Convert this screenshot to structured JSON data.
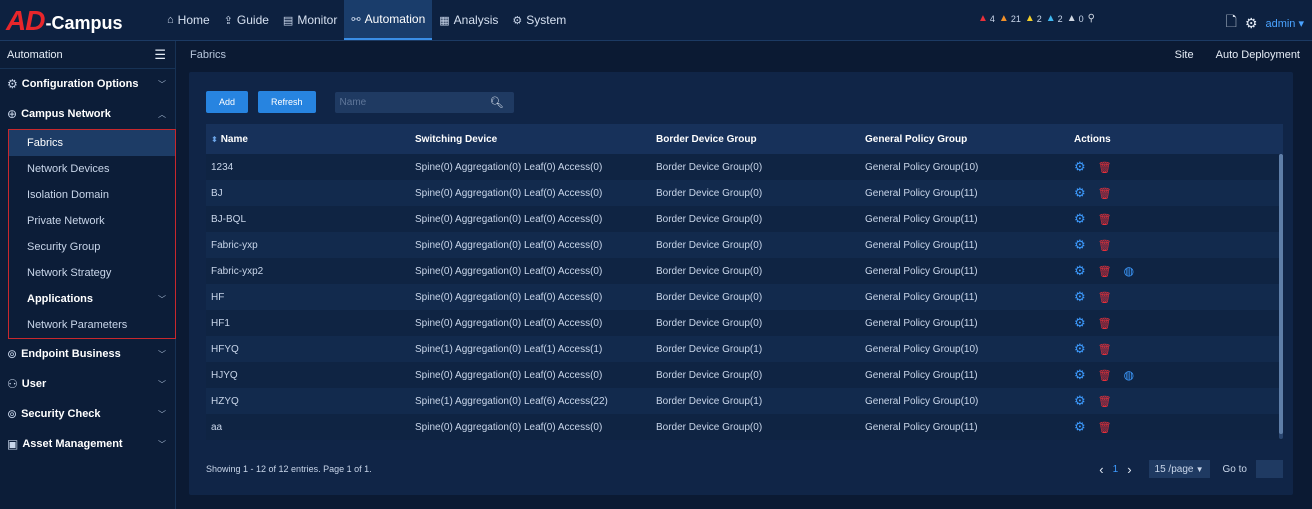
{
  "brand": {
    "logo_ad": "AD",
    "logo_rest": "-Campus"
  },
  "nav": [
    {
      "icon": "⌂",
      "label": "Home",
      "active": false
    },
    {
      "icon": "⇪",
      "label": "Guide",
      "active": false
    },
    {
      "icon": "▤",
      "label": "Monitor",
      "active": false
    },
    {
      "icon": "⚯",
      "label": "Automation",
      "active": true
    },
    {
      "icon": "▦",
      "label": "Analysis",
      "active": false
    },
    {
      "icon": "⚙",
      "label": "System",
      "active": false
    }
  ],
  "alerts": [
    {
      "count": "4",
      "color": "#e8303a"
    },
    {
      "count": "21",
      "color": "#f0902a"
    },
    {
      "count": "2",
      "color": "#f3cf2a"
    },
    {
      "count": "2",
      "color": "#3fb7f0"
    },
    {
      "count": "0",
      "color": "#d0d7e2"
    }
  ],
  "user": {
    "name": "admin"
  },
  "sidebar": {
    "title": "Automation",
    "groups_top": [
      {
        "icon": "⚙",
        "label": "Configuration Options"
      },
      {
        "icon": "⊕",
        "label": "Campus Network"
      }
    ],
    "sub_items": [
      {
        "label": "Fabrics",
        "active": true,
        "bold": false
      },
      {
        "label": "Network Devices",
        "active": false,
        "bold": false
      },
      {
        "label": "Isolation Domain",
        "active": false,
        "bold": false
      },
      {
        "label": "Private Network",
        "active": false,
        "bold": false
      },
      {
        "label": "Security Group",
        "active": false,
        "bold": false
      },
      {
        "label": "Network Strategy",
        "active": false,
        "bold": false
      },
      {
        "label": "Applications",
        "active": false,
        "bold": true
      },
      {
        "label": "Network Parameters",
        "active": false,
        "bold": false
      }
    ],
    "groups_bottom": [
      {
        "icon": "⊚",
        "label": "Endpoint Business"
      },
      {
        "icon": "⚇",
        "label": "User"
      },
      {
        "icon": "⊚",
        "label": "Security Check"
      },
      {
        "icon": "▣",
        "label": "Asset Management"
      }
    ]
  },
  "breadcrumb": "Fabrics",
  "header_links": [
    "Site",
    "Auto Deployment"
  ],
  "toolbar": {
    "add_label": "Add",
    "refresh_label": "Refresh",
    "search_placeholder": "Name"
  },
  "table": {
    "columns": [
      "Name",
      "Switching Device",
      "Border Device Group",
      "General Policy Group",
      "Actions"
    ],
    "rows": [
      {
        "name": "1234",
        "switching": "Spine(0) Aggregation(0) Leaf(0) Access(0)",
        "border": "Border Device Group(0)",
        "policy": "General Policy Group(10)",
        "net": false
      },
      {
        "name": "BJ",
        "switching": "Spine(0) Aggregation(0) Leaf(0) Access(0)",
        "border": "Border Device Group(0)",
        "policy": "General Policy Group(11)",
        "net": false
      },
      {
        "name": "BJ-BQL",
        "switching": "Spine(0) Aggregation(0) Leaf(0) Access(0)",
        "border": "Border Device Group(0)",
        "policy": "General Policy Group(11)",
        "net": false
      },
      {
        "name": "Fabric-yxp",
        "switching": "Spine(0) Aggregation(0) Leaf(0) Access(0)",
        "border": "Border Device Group(0)",
        "policy": "General Policy Group(11)",
        "net": false
      },
      {
        "name": "Fabric-yxp2",
        "switching": "Spine(0) Aggregation(0) Leaf(0) Access(0)",
        "border": "Border Device Group(0)",
        "policy": "General Policy Group(11)",
        "net": true
      },
      {
        "name": "HF",
        "switching": "Spine(0) Aggregation(0) Leaf(0) Access(0)",
        "border": "Border Device Group(0)",
        "policy": "General Policy Group(11)",
        "net": false
      },
      {
        "name": "HF1",
        "switching": "Spine(0) Aggregation(0) Leaf(0) Access(0)",
        "border": "Border Device Group(0)",
        "policy": "General Policy Group(11)",
        "net": false
      },
      {
        "name": "HFYQ",
        "switching": "Spine(1) Aggregation(0) Leaf(1) Access(1)",
        "border": "Border Device Group(1)",
        "policy": "General Policy Group(10)",
        "net": false
      },
      {
        "name": "HJYQ",
        "switching": "Spine(0) Aggregation(0) Leaf(0) Access(0)",
        "border": "Border Device Group(0)",
        "policy": "General Policy Group(11)",
        "net": true
      },
      {
        "name": "HZYQ",
        "switching": "Spine(1) Aggregation(0) Leaf(6) Access(22)",
        "border": "Border Device Group(1)",
        "policy": "General Policy Group(10)",
        "net": false
      },
      {
        "name": "aa",
        "switching": "Spine(0) Aggregation(0) Leaf(0) Access(0)",
        "border": "Border Device Group(0)",
        "policy": "General Policy Group(11)",
        "net": false
      }
    ]
  },
  "footer": {
    "info": "Showing 1 - 12 of 12 entries. Page 1 of 1.",
    "current_page": "1",
    "page_size": "15 /page",
    "goto_label": "Go to"
  }
}
